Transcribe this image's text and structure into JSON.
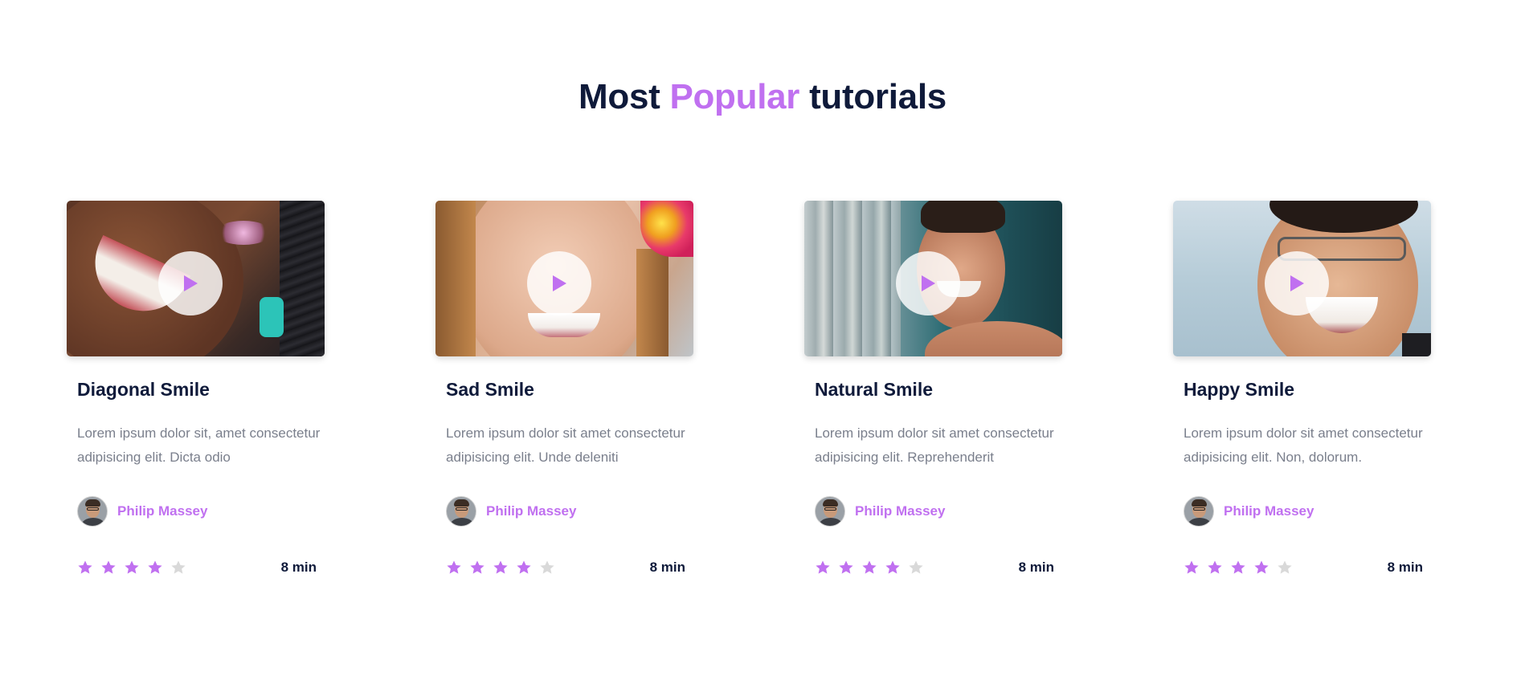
{
  "heading": {
    "prefix": "Most ",
    "accent": "Popular",
    "suffix": " tutorials"
  },
  "colors": {
    "accent": "#c070f0",
    "heading": "#0f1a3a",
    "text_muted": "#7a7f8c",
    "star_empty": "#d9d9d9"
  },
  "icons": {
    "play": "play-icon",
    "star": "star-icon"
  },
  "cards": [
    {
      "title": "Diagonal Smile",
      "description": "Lorem ipsum dolor sit, amet consectetur adipisicing elit. Dicta odio",
      "author": "Philip Massey",
      "rating": 4,
      "rating_max": 5,
      "duration": "8 min"
    },
    {
      "title": "Sad Smile",
      "description": "Lorem ipsum dolor sit amet consectetur adipisicing elit. Unde deleniti",
      "author": "Philip Massey",
      "rating": 4,
      "rating_max": 5,
      "duration": "8 min"
    },
    {
      "title": "Natural Smile",
      "description": "Lorem ipsum dolor sit amet consectetur adipisicing elit. Reprehenderit",
      "author": "Philip Massey",
      "rating": 4,
      "rating_max": 5,
      "duration": "8 min"
    },
    {
      "title": "Happy Smile",
      "description": "Lorem ipsum dolor sit amet consectetur adipisicing elit. Non, dolorum.",
      "author": "Philip Massey",
      "rating": 4,
      "rating_max": 5,
      "duration": "8 min"
    }
  ]
}
